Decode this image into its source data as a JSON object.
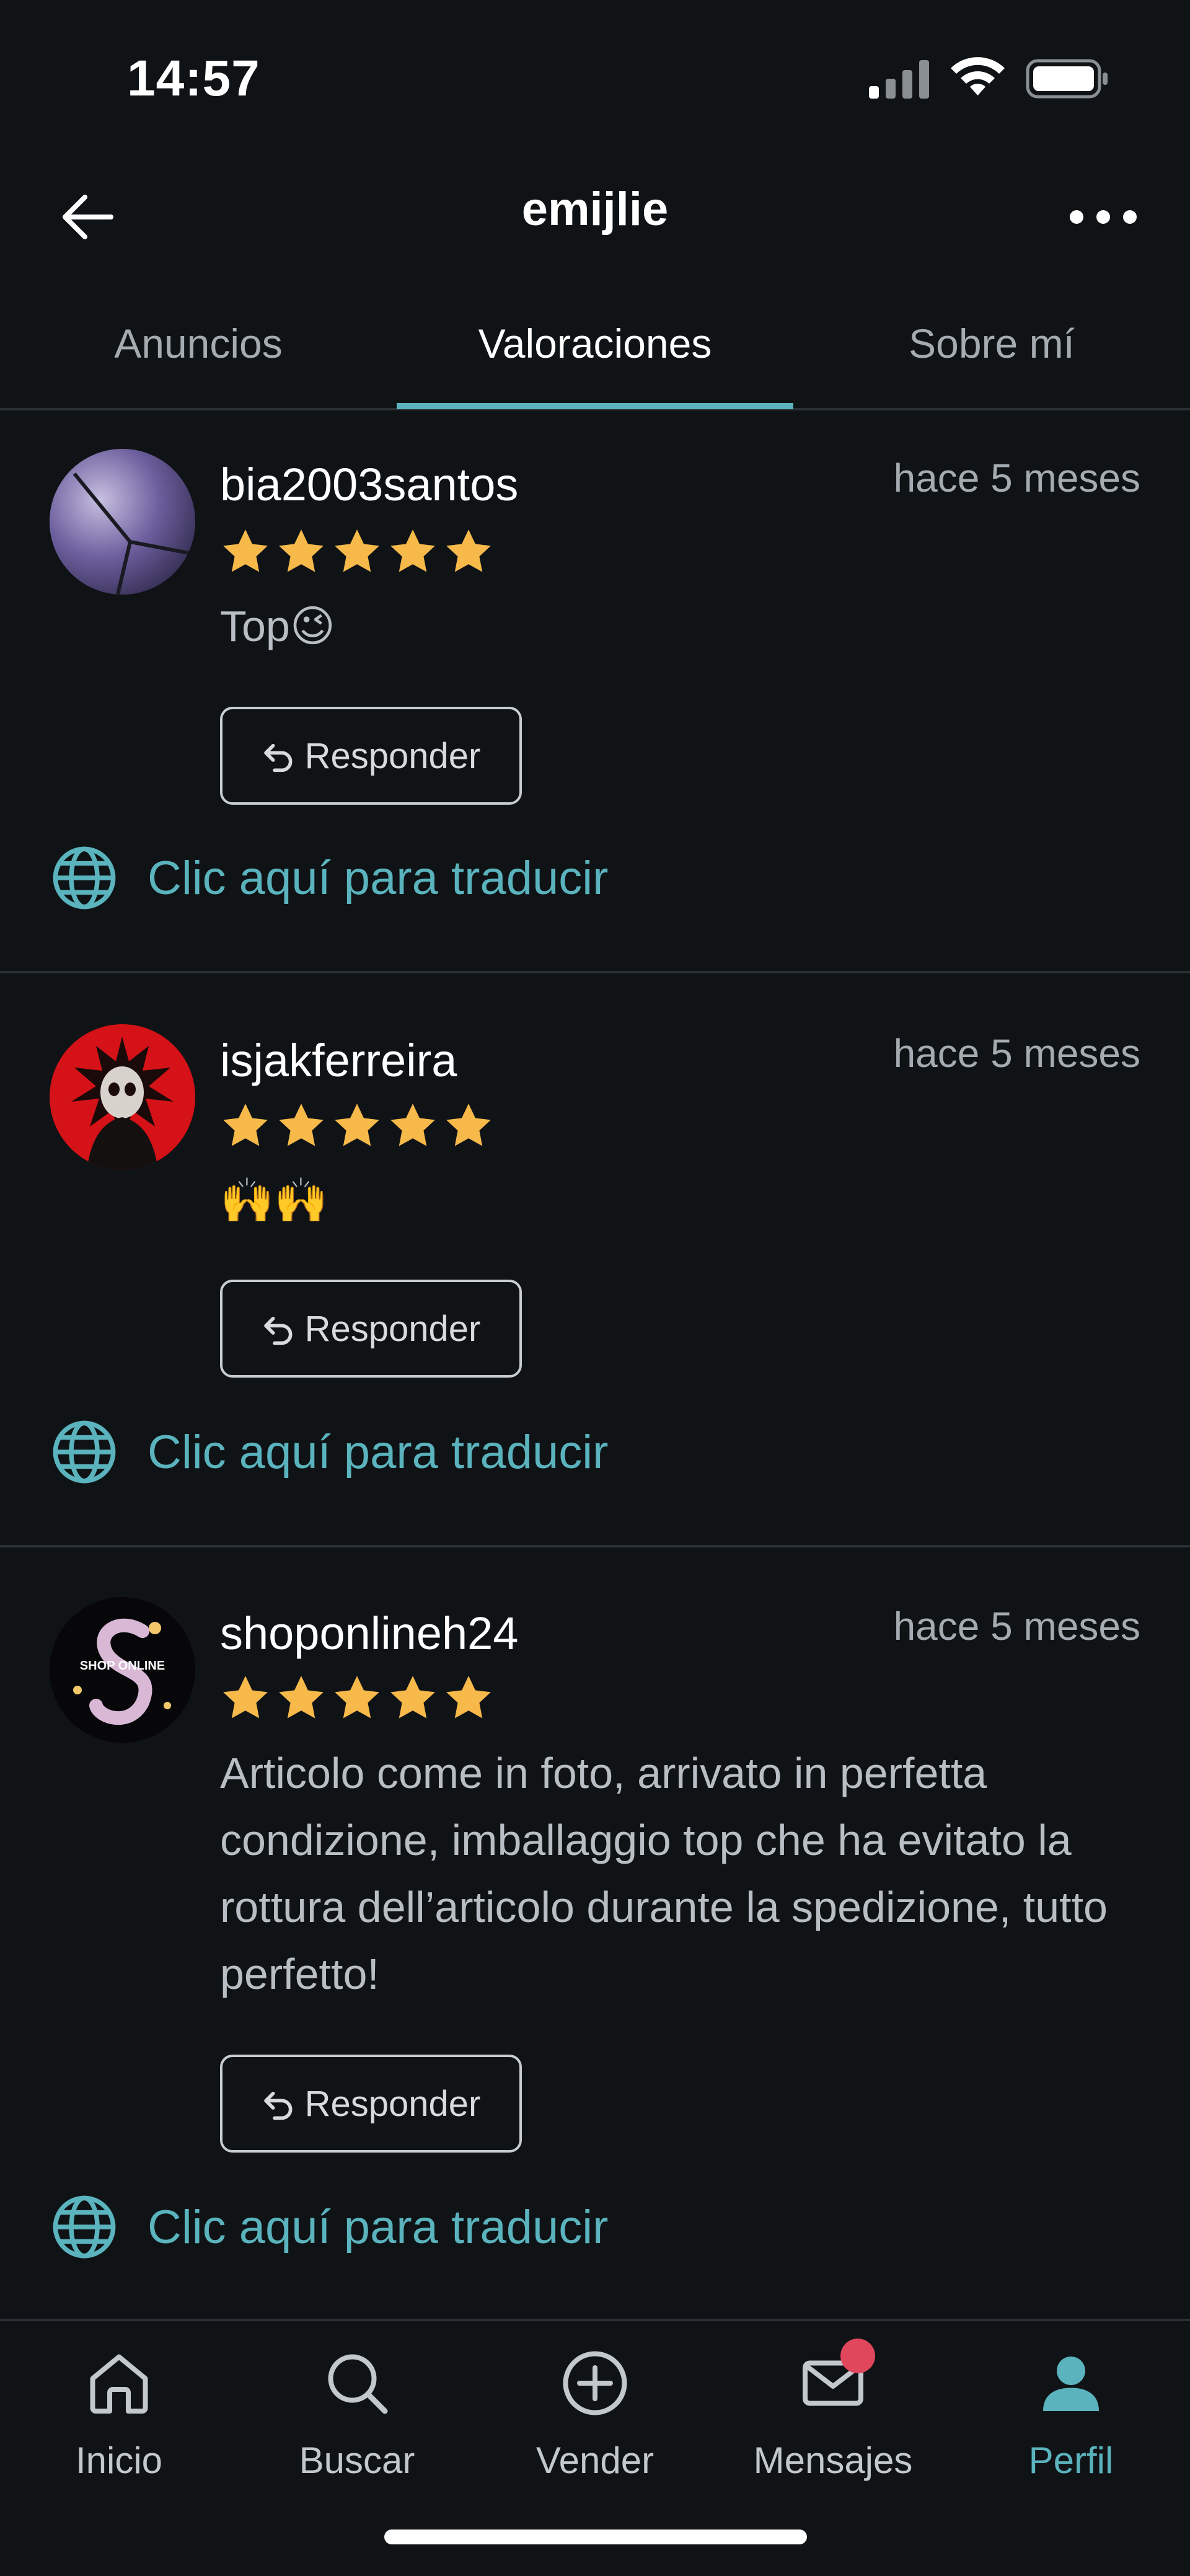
{
  "status_bar": {
    "time": "14:57"
  },
  "header": {
    "title": "emijlie"
  },
  "tabs": [
    {
      "label": "Anuncios",
      "active": false
    },
    {
      "label": "Valoraciones",
      "active": true
    },
    {
      "label": "Sobre mí",
      "active": false
    }
  ],
  "reviews": [
    {
      "username": "bia2003santos",
      "time_ago": "hace 5 meses",
      "rating": 5,
      "comment": "Top😉",
      "reply_label": "Responder",
      "translate_label": "Clic aquí para traducir"
    },
    {
      "username": "isjakferreira",
      "time_ago": "hace 5 meses",
      "rating": 5,
      "comment": "🙌🙌",
      "reply_label": "Responder",
      "translate_label": "Clic aquí para traducir"
    },
    {
      "username": "shoponlineh24",
      "time_ago": "hace 5 meses",
      "rating": 5,
      "comment": "Articolo come in foto, arrivato in perfetta condizione, imballaggio top che ha evitato la rottura dell’articolo durante la spedizione, tutto perfetto!",
      "reply_label": "Responder",
      "translate_label": "Clic aquí para traducir",
      "avatar_text": "SHOP ONLINE"
    }
  ],
  "bottom_nav": [
    {
      "label": "Inicio",
      "icon": "home-icon"
    },
    {
      "label": "Buscar",
      "icon": "search-icon"
    },
    {
      "label": "Vender",
      "icon": "plus-circle-icon"
    },
    {
      "label": "Mensajes",
      "icon": "mail-icon",
      "has_badge": true
    },
    {
      "label": "Perfil",
      "icon": "person-icon",
      "active": true
    }
  ],
  "colors": {
    "background": "#0f1316",
    "accent": "#5ab3bd",
    "star": "#f6b94a",
    "badge": "#e0465c"
  }
}
